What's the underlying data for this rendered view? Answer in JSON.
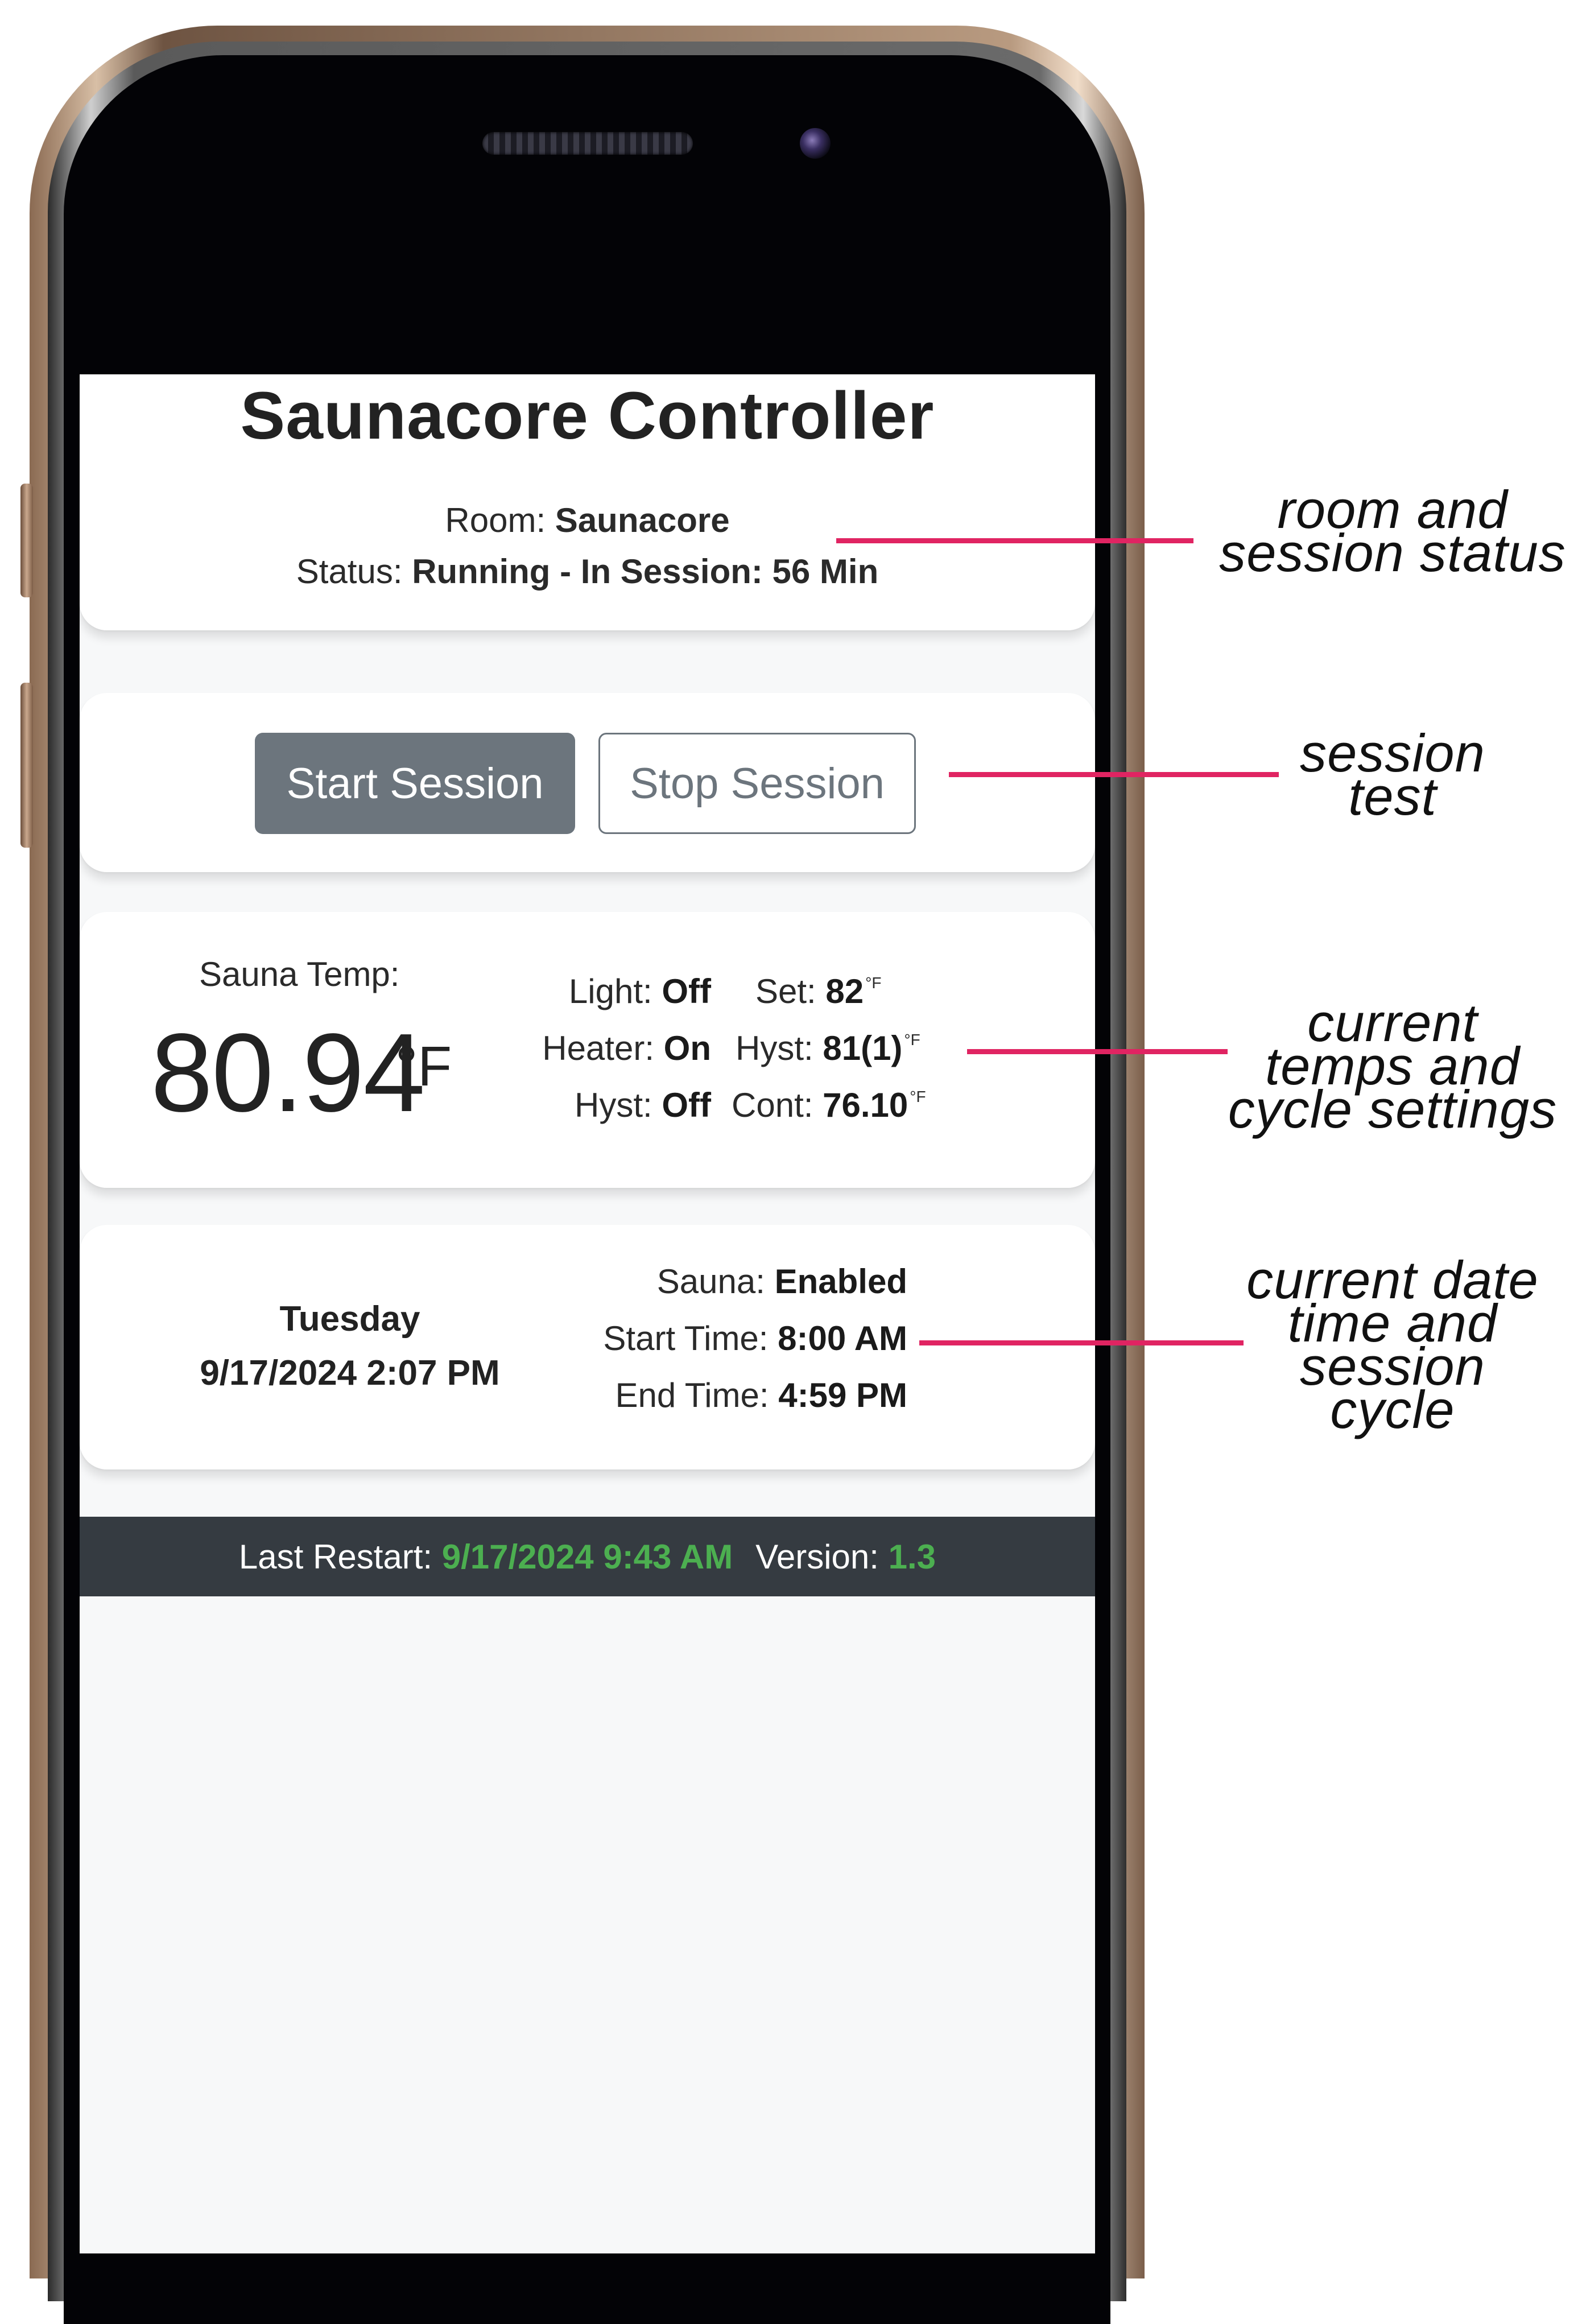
{
  "app": {
    "title": "Saunacore Controller",
    "room_label": "Room:",
    "room_value": "Saunacore",
    "status_label": "Status:",
    "status_value": "Running - In Session: 56 Min"
  },
  "controls": {
    "start_label": "Start Session",
    "stop_label": "Stop Session"
  },
  "temps": {
    "sauna_temp_label": "Sauna Temp:",
    "sauna_temp_value": "80.94",
    "sauna_temp_unit": "°F",
    "light_label": "Light:",
    "light_value": "Off",
    "heater_label": "Heater:",
    "heater_value": "On",
    "hyst_state_label": "Hyst:",
    "hyst_state_value": "Off",
    "set_label": "Set:",
    "set_value": "82",
    "hyst_label": "Hyst:",
    "hyst_value": "81(1)",
    "cont_label": "Cont:",
    "cont_value": "76.10",
    "small_unit": "°F"
  },
  "schedule": {
    "day": "Tuesday",
    "datetime": "9/17/2024 2:07 PM",
    "sauna_label": "Sauna:",
    "sauna_value": "Enabled",
    "start_label": "Start Time:",
    "start_value": "8:00 AM",
    "end_label": "End Time:",
    "end_value": "4:59 PM"
  },
  "footer": {
    "restart_label": "Last Restart:",
    "restart_value": "9/17/2024 9:43 AM",
    "version_label": "Version:",
    "version_value": "1.3"
  },
  "annotations": {
    "room_status": [
      "room and",
      "session status"
    ],
    "session_test": [
      "session",
      "test"
    ],
    "temps": [
      "current",
      "temps and",
      "cycle settings"
    ],
    "date_time": [
      "current date",
      "time and",
      "session",
      "cycle"
    ]
  },
  "colors": {
    "annotation_line": "#e02462",
    "footer_bg": "#353b41",
    "footer_value": "#4caf50",
    "start_button_bg": "#6c757d"
  }
}
